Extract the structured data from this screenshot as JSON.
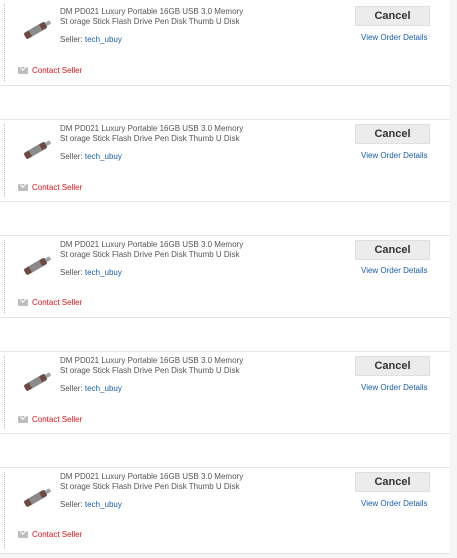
{
  "orders": [
    {
      "title": "DM PD021 Luxury Portable 16GB USB 3.0 Memory St orage Stick Flash Drive Pen Disk Thumb U Disk",
      "seller_label": "Seller:",
      "seller_name": "tech_ubuy",
      "contact": "Contact Seller",
      "cancel": "Cancel",
      "details": "View Order Details"
    },
    {
      "title": "DM PD021 Luxury Portable 16GB USB 3.0 Memory St orage Stick Flash Drive Pen Disk Thumb U Disk",
      "seller_label": "Seller:",
      "seller_name": "tech_ubuy",
      "contact": "Contact Seller",
      "cancel": "Cancel",
      "details": "View Order Details"
    },
    {
      "title": "DM PD021 Luxury Portable 16GB USB 3.0 Memory St orage Stick Flash Drive Pen Disk Thumb U Disk",
      "seller_label": "Seller:",
      "seller_name": "tech_ubuy",
      "contact": "Contact Seller",
      "cancel": "Cancel",
      "details": "View Order Details"
    },
    {
      "title": "DM PD021 Luxury Portable 16GB USB 3.0 Memory St orage Stick Flash Drive Pen Disk Thumb U Disk",
      "seller_label": "Seller:",
      "seller_name": "tech_ubuy",
      "contact": "Contact Seller",
      "cancel": "Cancel",
      "details": "View Order Details"
    },
    {
      "title": "DM PD021 Luxury Portable 16GB USB 3.0 Memory St orage Stick Flash Drive Pen Disk Thumb U Disk",
      "seller_label": "Seller:",
      "seller_name": "tech_ubuy",
      "contact": "Contact Seller",
      "cancel": "Cancel",
      "details": "View Order Details"
    }
  ],
  "colors": {
    "link": "#1a5fa5",
    "contact": "#d9121a"
  },
  "icons": {
    "product": "usb-flash-drive-icon",
    "contact": "mail-icon"
  }
}
